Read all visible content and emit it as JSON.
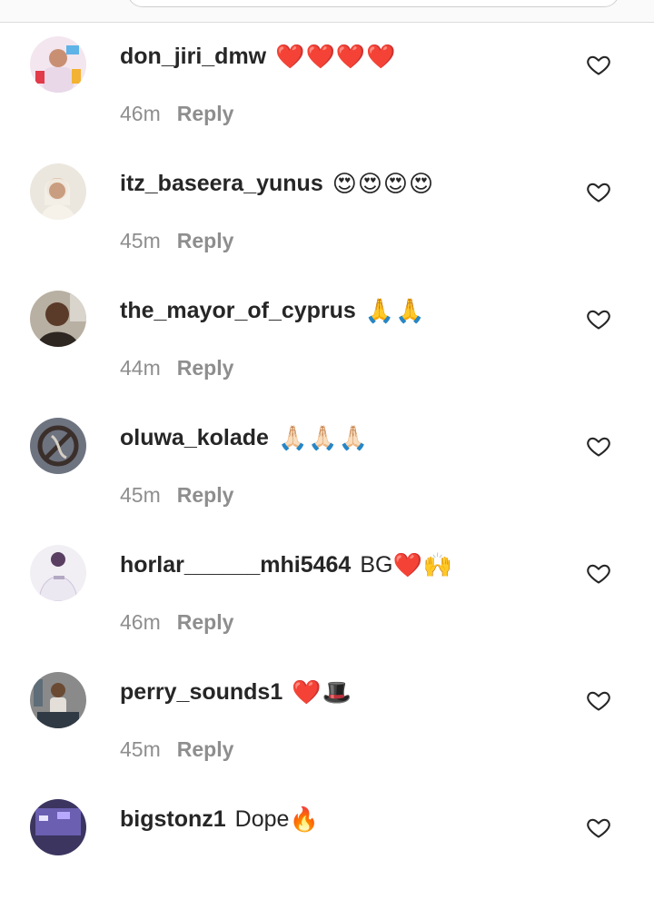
{
  "comments": [
    {
      "username": "don_jiri_dmw",
      "text": "",
      "emoji": "❤️❤️❤️❤️",
      "time": "46m",
      "reply": "Reply"
    },
    {
      "username": "itz_baseera_yunus",
      "text": "",
      "emoji": "😍😍😍😍",
      "time": "45m",
      "reply": "Reply"
    },
    {
      "username": "the_mayor_of_cyprus",
      "text": "",
      "emoji": "🙏🙏",
      "time": "44m",
      "reply": "Reply"
    },
    {
      "username": "oluwa_kolade",
      "text": "",
      "emoji": "🙏🏻🙏🏻🙏🏻",
      "time": "45m",
      "reply": "Reply"
    },
    {
      "username": "horlar______mhi5464",
      "text": "BG",
      "emoji": "❤️🙌",
      "time": "46m",
      "reply": "Reply"
    },
    {
      "username": "perry_sounds1",
      "text": "",
      "emoji": "❤️🎩",
      "time": "45m",
      "reply": "Reply"
    },
    {
      "username": "bigstonz1",
      "text": "Dope",
      "emoji": "🔥",
      "time": "",
      "reply": ""
    }
  ],
  "colors": {
    "username": "#262626",
    "meta": "#8e8e8e",
    "heart_outline": "#262626",
    "divider": "#dcdcdc"
  },
  "icons": {
    "like": "heart-outline-icon",
    "avatar": "profile-photo"
  }
}
